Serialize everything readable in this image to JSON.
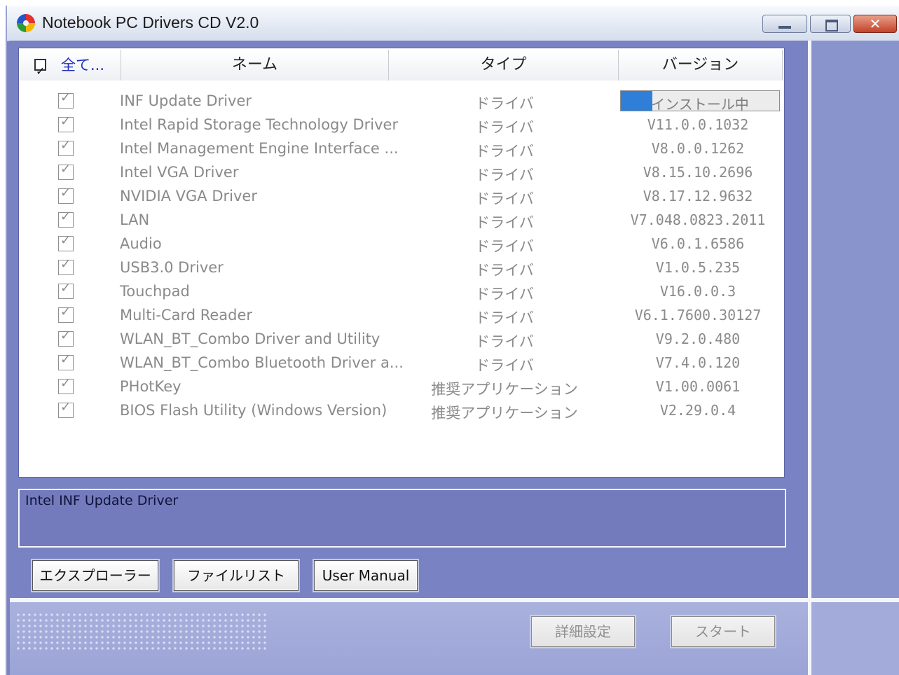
{
  "window": {
    "title": "Notebook PC Drivers CD V2.0",
    "buttons": {
      "minimize_icon": "minimize-icon",
      "maximize_icon": "maximize-icon",
      "close_icon": "close-icon",
      "close_glyph": "✕"
    }
  },
  "list": {
    "headers": {
      "select_all": "全て...",
      "name": "ネーム",
      "type": "タイプ",
      "version": "バージョン"
    },
    "rows": [
      {
        "checked": true,
        "name": "INF Update Driver",
        "type": "ドライバ",
        "version": "インストール中",
        "installing": true,
        "progress": 0.2
      },
      {
        "checked": true,
        "name": "Intel Rapid Storage Technology Driver",
        "type": "ドライバ",
        "version": "V11.0.0.1032"
      },
      {
        "checked": true,
        "name": "Intel Management Engine Interface ...",
        "type": "ドライバ",
        "version": "V8.0.0.1262"
      },
      {
        "checked": true,
        "name": "Intel VGA Driver",
        "type": "ドライバ",
        "version": "V8.15.10.2696"
      },
      {
        "checked": true,
        "name": "NVIDIA VGA Driver",
        "type": "ドライバ",
        "version": "V8.17.12.9632"
      },
      {
        "checked": true,
        "name": "LAN",
        "type": "ドライバ",
        "version": "V7.048.0823.2011"
      },
      {
        "checked": true,
        "name": "Audio",
        "type": "ドライバ",
        "version": "V6.0.1.6586"
      },
      {
        "checked": true,
        "name": "USB3.0 Driver",
        "type": "ドライバ",
        "version": "V1.0.5.235"
      },
      {
        "checked": true,
        "name": "Touchpad",
        "type": "ドライバ",
        "version": "V16.0.0.3"
      },
      {
        "checked": true,
        "name": "Multi-Card Reader",
        "type": "ドライバ",
        "version": "V6.1.7600.30127"
      },
      {
        "checked": true,
        "name": "WLAN_BT_Combo Driver and Utility",
        "type": "ドライバ",
        "version": "V9.2.0.480"
      },
      {
        "checked": true,
        "name": "WLAN_BT_Combo Bluetooth Driver a...",
        "type": "ドライバ",
        "version": "V7.4.0.120"
      },
      {
        "checked": true,
        "name": "PHotKey",
        "type": "推奨アプリケーション",
        "version": "V1.00.0061"
      },
      {
        "checked": true,
        "name": "BIOS Flash Utility (Windows Version)",
        "type": "推奨アプリケーション",
        "version": "V2.29.0.4"
      }
    ]
  },
  "description": {
    "text": "Intel INF Update Driver"
  },
  "buttons": {
    "explorer": "エクスプローラー",
    "file_list": "ファイルリスト",
    "user_manual": "User Manual",
    "advanced": "詳細設定",
    "start": "スタート"
  },
  "colors": {
    "accent": "#7982c2",
    "progress": "#2f7fd9",
    "header_link": "#1d2cbf"
  }
}
